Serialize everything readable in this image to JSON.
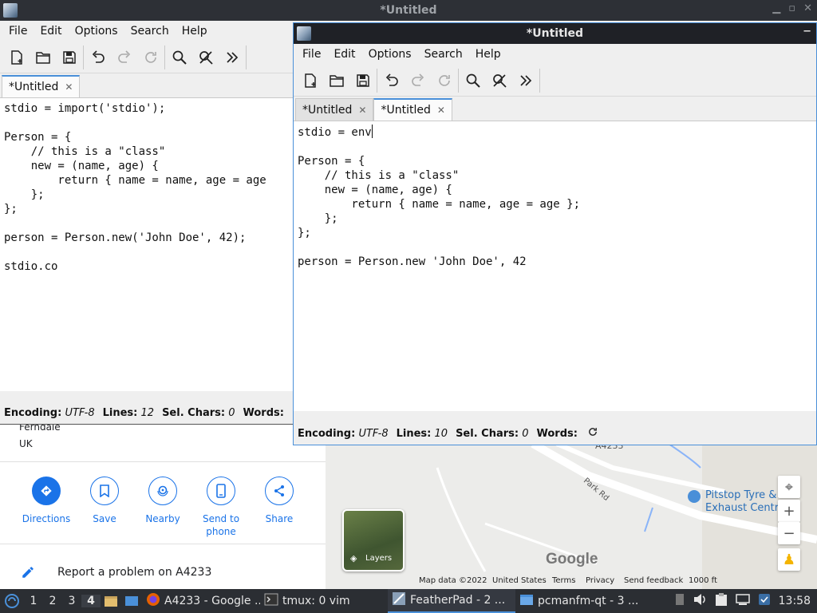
{
  "background_page": {
    "address": [
      "Ferndale",
      "UK"
    ],
    "actions": [
      {
        "label": "Directions",
        "icon": "directions-icon"
      },
      {
        "label": "Save",
        "icon": "bookmark-icon"
      },
      {
        "label": "Nearby",
        "icon": "nearby-icon"
      },
      {
        "label": "Send to phone",
        "icon": "phone-icon"
      },
      {
        "label": "Share",
        "icon": "share-icon"
      }
    ],
    "report_link": "Report a problem on A4233",
    "map": {
      "road_label": "A4233",
      "street_label": "Park Rd",
      "poi": "Pitstop Tyre & Exhaust Centre",
      "layers_label": "Layers",
      "logo": "Google",
      "footer": {
        "map_data": "Map data ©2022",
        "country": "United States",
        "terms": "Terms",
        "privacy": "Privacy",
        "feedback": "Send feedback",
        "scale": "1000 ft"
      }
    }
  },
  "window_back": {
    "title": "*Untitled",
    "menu": [
      "File",
      "Edit",
      "Options",
      "Search",
      "Help"
    ],
    "tabs": [
      {
        "label": "*Untitled",
        "current": true
      }
    ],
    "code": "stdio = import('stdio');\n\nPerson = {\n    // this is a \"class\"\n    new = (name, age) {\n        return { name = name, age = age\n    };\n};\n\nperson = Person.new('John Doe', 42);\n\nstdio.co",
    "status": {
      "encoding_label": "Encoding:",
      "encoding": "UTF-8",
      "lines_label": "Lines:",
      "lines": "12",
      "sel_label": "Sel. Chars:",
      "sel": "0",
      "words_label": "Words:"
    }
  },
  "window_front": {
    "title": "*Untitled",
    "menu": [
      "File",
      "Edit",
      "Options",
      "Search",
      "Help"
    ],
    "tabs": [
      {
        "label": "*Untitled",
        "current": false
      },
      {
        "label": "*Untitled",
        "current": true
      }
    ],
    "code_before_caret": "stdio = env",
    "code_after_caret": "\n\nPerson = {\n    // this is a \"class\"\n    new = (name, age) {\n        return { name = name, age = age };\n    };\n};\n\nperson = Person.new 'John Doe', 42",
    "status": {
      "encoding_label": "Encoding:",
      "encoding": "UTF-8",
      "lines_label": "Lines:",
      "lines": "10",
      "sel_label": "Sel. Chars:",
      "sel": "0",
      "words_label": "Words:"
    }
  },
  "taskbar": {
    "workspaces": [
      "1",
      "2",
      "3",
      "4"
    ],
    "current_workspace": "4",
    "tasks": [
      {
        "label": "A4233 - Google ...",
        "icon": "firefox-icon"
      },
      {
        "label": "tmux: 0 vim",
        "icon": "terminal-icon"
      },
      {
        "label": "FeatherPad - 2 ...",
        "icon": "featherpad-icon",
        "active": true
      },
      {
        "label": "pcmanfm-qt - 3 ...",
        "icon": "folder-icon"
      }
    ],
    "clock": "13:58"
  },
  "colors": {
    "accent": "#4a90d9",
    "maps_blue": "#1a73e8",
    "titlebar_active": "#1f2126",
    "panel": "#2b2e33"
  }
}
